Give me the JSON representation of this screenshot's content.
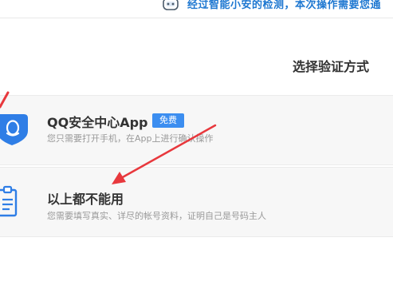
{
  "banner": {
    "text": "经过智能小安的检测，本次操作需要您通",
    "icon": "robot-icon"
  },
  "section_title": "选择验证方式",
  "options": [
    {
      "title": "QQ安全中心App",
      "badge": "免费",
      "description": "您只需要打开手机，在App上进行确认操作",
      "icon": "qq-shield-icon"
    },
    {
      "title": "以上都不能用",
      "description": "您需要填写真实、详尽的帐号资料，证明自己是号码主人",
      "icon": "clipboard-icon"
    }
  ],
  "colors": {
    "accent": "#3c8ef0",
    "banner_text": "#1f78d1",
    "annotation_arrow": "#e8383d",
    "card_background": "#f7f7f7"
  }
}
